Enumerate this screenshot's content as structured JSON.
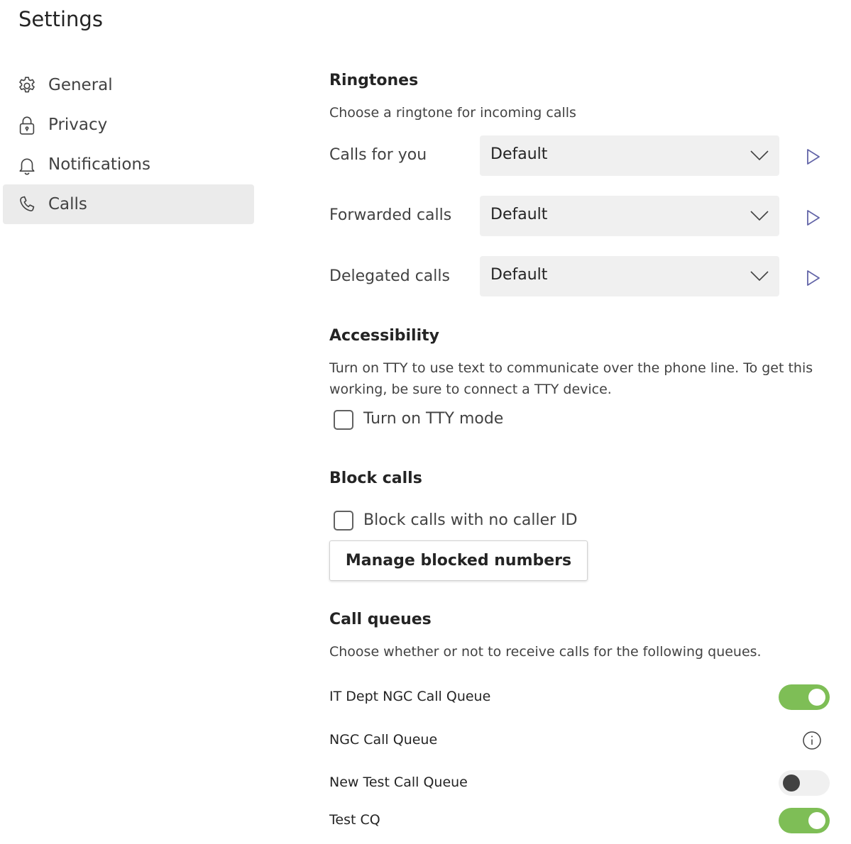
{
  "page": {
    "title": "Settings"
  },
  "nav": {
    "items": [
      {
        "label": "General",
        "icon": "gear-icon"
      },
      {
        "label": "Privacy",
        "icon": "lock-icon"
      },
      {
        "label": "Notifications",
        "icon": "bell-icon"
      },
      {
        "label": "Calls",
        "icon": "phone-icon",
        "active": true
      }
    ]
  },
  "ringtones": {
    "heading": "Ringtones",
    "description": "Choose a ringtone for incoming calls",
    "rows": [
      {
        "label": "Calls for you",
        "value": "Default"
      },
      {
        "label": "Forwarded calls",
        "value": "Default"
      },
      {
        "label": "Delegated calls",
        "value": "Default"
      }
    ]
  },
  "accessibility": {
    "heading": "Accessibility",
    "description_line1": "Turn on TTY to use text to communicate over the phone line. To get this",
    "description_line2": "working, be sure to connect a TTY device.",
    "tty_label": "Turn on TTY mode",
    "tty_checked": false
  },
  "block_calls": {
    "heading": "Block calls",
    "no_caller_id_label": "Block calls with no caller ID",
    "no_caller_id_checked": false,
    "manage_button": "Manage blocked numbers"
  },
  "call_queues": {
    "heading": "Call queues",
    "description": "Choose whether or not to receive calls for the following queues.",
    "queues": [
      {
        "label": "IT Dept NGC Call Queue",
        "control": "toggle",
        "state": "on"
      },
      {
        "label": "NGC Call Queue",
        "control": "info-icon"
      },
      {
        "label": "New Test Call Queue",
        "control": "toggle",
        "state": "off"
      },
      {
        "label": "Test CQ",
        "control": "toggle",
        "state": "on"
      }
    ]
  },
  "colors": {
    "accent": "#6264a7",
    "toggle_on": "#7ebe56",
    "active_nav_bg": "#ebebeb",
    "select_bg": "#f0f0f0"
  }
}
